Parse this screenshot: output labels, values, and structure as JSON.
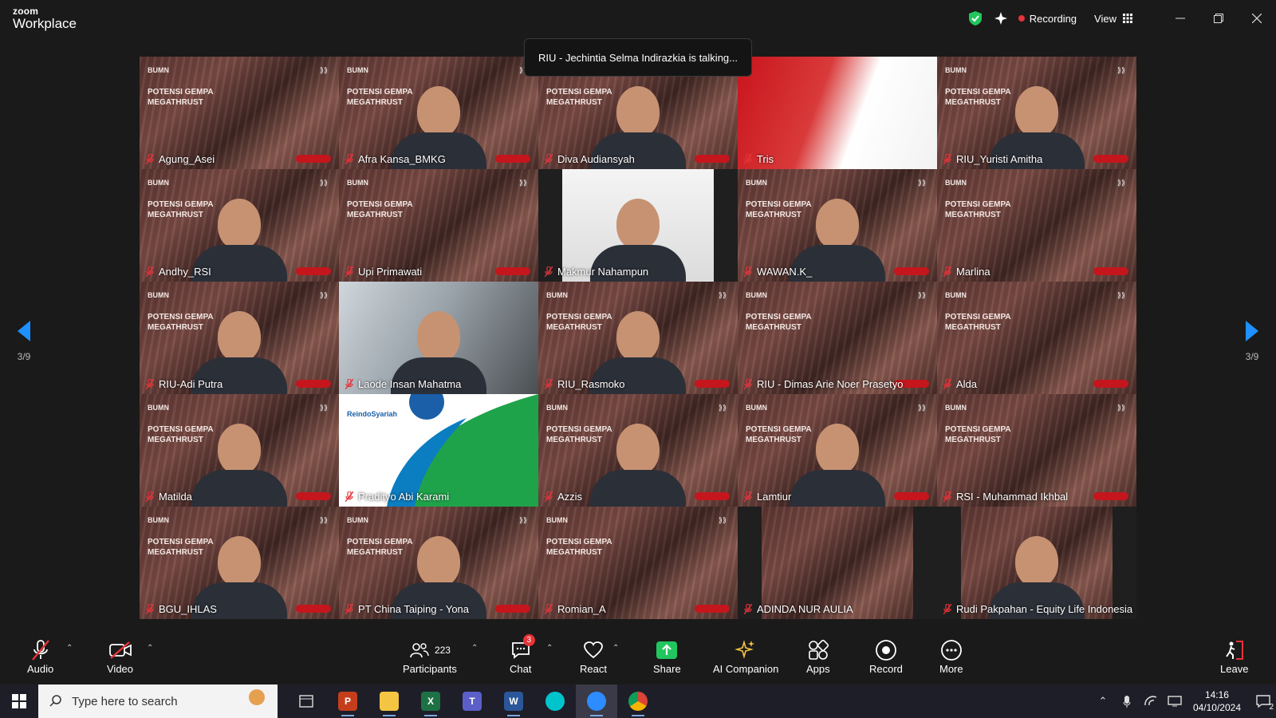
{
  "app": {
    "brand_small": "zoom",
    "brand_big": "Workplace"
  },
  "header": {
    "recording_label": "Recording",
    "view_label": "View"
  },
  "talking_indicator": "RIU - Jechintia Selma Indirazkia is talking...",
  "poster": {
    "brand": "BUMN",
    "line1": "POTENSI GEMPA",
    "line2": "MEGATHRUST"
  },
  "reindo_logo_text": "ReindoSyariah",
  "gallery": {
    "page_left": "3/9",
    "page_right": "3/9",
    "tiles": [
      {
        "name": "Agung_Asei"
      },
      {
        "name": "Afra Kansa_BMKG"
      },
      {
        "name": "Diva Audiansyah"
      },
      {
        "name": "Tris"
      },
      {
        "name": "RIU_Yuristi Amitha"
      },
      {
        "name": "Andhy_RSI"
      },
      {
        "name": "Upi Primawati"
      },
      {
        "name": "Makmur Nahampun"
      },
      {
        "name": "WAWAN.K_"
      },
      {
        "name": "Marlina"
      },
      {
        "name": "RIU-Adi Putra"
      },
      {
        "name": "Laode Insan Mahatma"
      },
      {
        "name": "RIU_Rasmoko"
      },
      {
        "name": "RIU - Dimas Arie Noer Prasetyo"
      },
      {
        "name": "Alda"
      },
      {
        "name": "Matilda"
      },
      {
        "name": "Pradityo Abi Karami"
      },
      {
        "name": "Azzis"
      },
      {
        "name": "Lamtiur"
      },
      {
        "name": "RSI - Muhammad Ikhbal"
      },
      {
        "name": "BGU_IHLAS"
      },
      {
        "name": "PT China Taiping - Yona"
      },
      {
        "name": "Romian_A"
      },
      {
        "name": "ADINDA NUR AULIA"
      },
      {
        "name": "Rudi Pakpahan - Equity Life Indonesia"
      }
    ]
  },
  "toolbar": {
    "audio": "Audio",
    "video": "Video",
    "participants": "Participants",
    "participants_count": "223",
    "chat": "Chat",
    "chat_badge": "3",
    "react": "React",
    "share": "Share",
    "ai_companion": "AI Companion",
    "apps": "Apps",
    "record": "Record",
    "more": "More",
    "leave": "Leave"
  },
  "taskbar": {
    "search_placeholder": "Type here to search",
    "time": "14:16",
    "date": "04/10/2024",
    "notification_count": "2"
  },
  "colors": {
    "accent_blue": "#1e90ff",
    "recording_red": "#e5343a",
    "mute_red": "#e5343a",
    "share_green": "#22c55e"
  }
}
